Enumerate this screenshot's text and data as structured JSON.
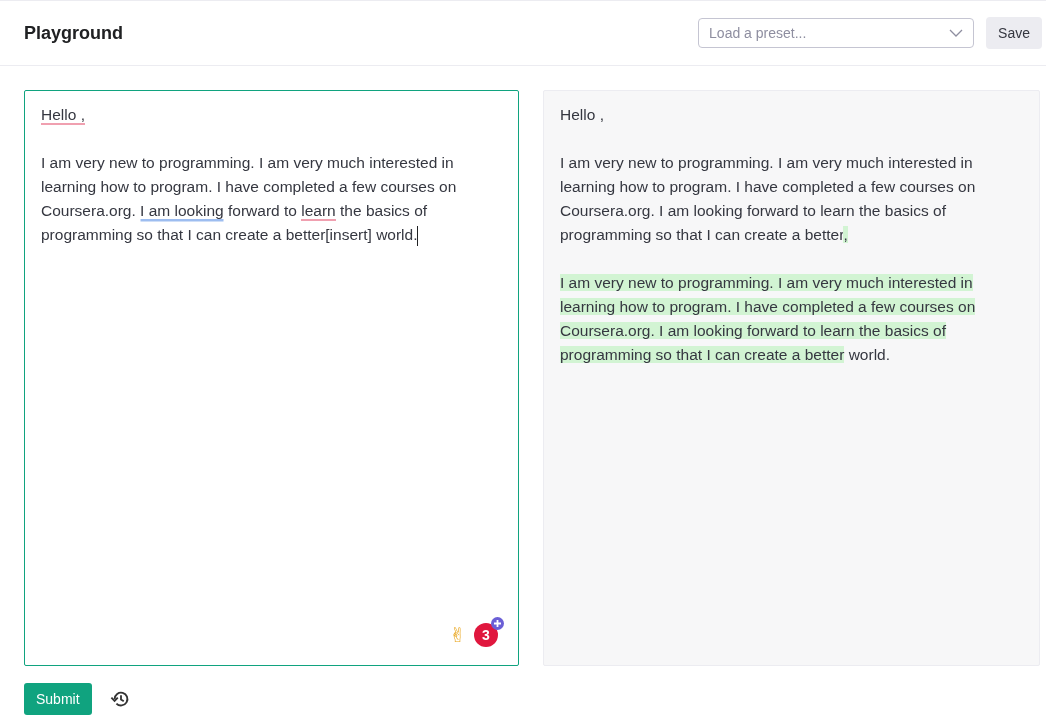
{
  "header": {
    "title": "Playground",
    "preset": {
      "placeholder": "Load a preset..."
    },
    "save_button": "Save"
  },
  "editor": {
    "focused": true,
    "paragraphs": [
      [
        [
          {
            "text": "Hello ,",
            "error": true,
            "suggestion": false
          }
        ]
      ],
      [
        [
          {
            "text": "I am very new to programming. I am very much interested in",
            "error": false,
            "suggestion": false
          }
        ],
        [
          {
            "text": "learning how to program. I have completed a few courses on",
            "error": false,
            "suggestion": false
          }
        ],
        [
          {
            "text": "Coursera.org.",
            "error": false,
            "suggestion": false
          },
          {
            "text": "I am looking",
            "error": false,
            "suggestion": true
          },
          {
            "text": "forward to",
            "error": false,
            "suggestion": false
          },
          {
            "text": "learn",
            "error": true,
            "suggestion": false
          },
          {
            "text": "the basics of",
            "error": false,
            "suggestion": false
          }
        ],
        [
          {
            "text": "programming so that I can create a better[insert] world.",
            "error": false,
            "suggestion": false
          }
        ]
      ]
    ],
    "caret": true,
    "emoji": "✌",
    "badge": {
      "count": "3"
    }
  },
  "output": {
    "paragraphs": [
      [
        [
          {
            "text": "Hello ,",
            "added": false
          }
        ]
      ],
      [
        [
          {
            "text": "I am very new to programming. I am very much interested in",
            "added": false
          }
        ],
        [
          {
            "text": "learning how to program. I have completed a few courses on",
            "added": false
          }
        ],
        [
          {
            "text": "Coursera.org. I am looking forward to learn the basics of",
            "added": false
          }
        ],
        [
          {
            "text": "programming so that I can create a better",
            "added": false
          },
          {
            "text": ",",
            "added": true
          }
        ]
      ],
      [
        [
          {
            "text": "I am very new to programming. I am very much interested in",
            "added": true
          }
        ],
        [
          {
            "text": "learning how to program. I have completed a few courses on",
            "added": true
          }
        ],
        [
          {
            "text": "Coursera.org. I am looking forward to learn the basics of",
            "added": true
          }
        ],
        [
          {
            "text": "programming so that I can create a better",
            "added": true
          },
          {
            "text": "world.",
            "added": false
          }
        ]
      ]
    ]
  },
  "footer": {
    "submit_button": "Submit"
  }
}
